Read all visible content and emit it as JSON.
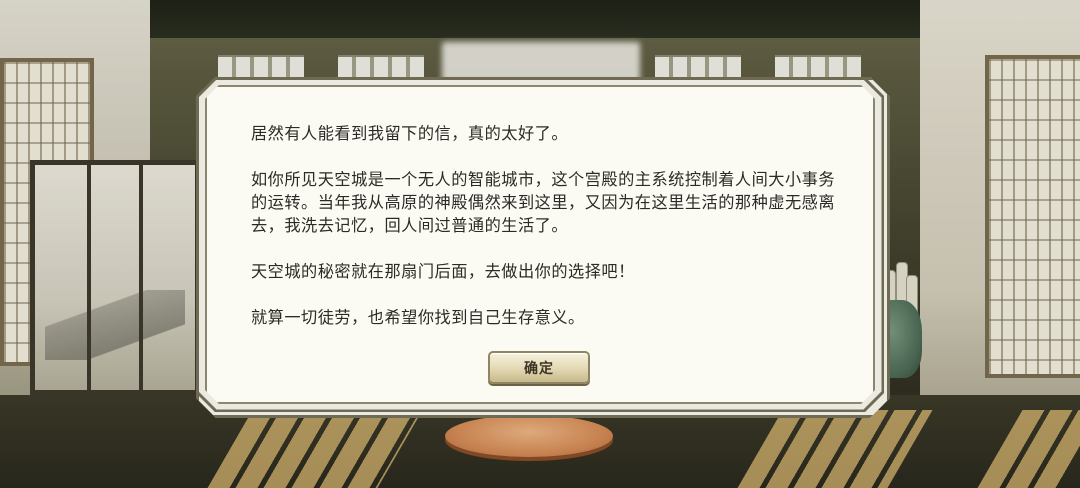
{
  "dialog": {
    "paragraphs": [
      "居然有人能看到我留下的信，真的太好了。",
      "如你所见天空城是一个无人的智能城市，这个宫殿的主系统控制着人间大小事务的运转。当年我从高原的神殿偶然来到这里，又因为在这里生活的那种虚无感离去，我洗去记忆，回人间过普通的生活了。",
      "天空城的秘密就在那扇门后面，去做出你的选择吧！",
      "就算一切徒劳，也希望你找到自己生存意义。"
    ],
    "confirm_label": "确定"
  },
  "colors": {
    "dialog_bg": "#fbfaf3",
    "dialog_border": "#6f6a54",
    "button_bg": "#e2d8b3",
    "text": "#2b2a26"
  }
}
